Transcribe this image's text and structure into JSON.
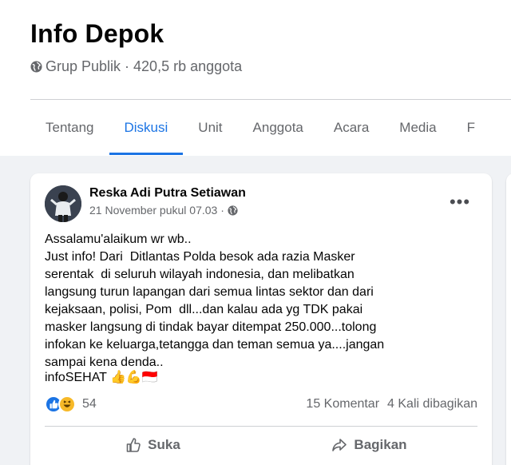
{
  "group": {
    "title": "Info Depok",
    "meta": "Grup Publik · 420,5 rb anggota"
  },
  "tabs": [
    {
      "label": "Tentang",
      "active": false
    },
    {
      "label": "Diskusi",
      "active": true
    },
    {
      "label": "Unit",
      "active": false
    },
    {
      "label": "Anggota",
      "active": false
    },
    {
      "label": "Acara",
      "active": false
    },
    {
      "label": "Media",
      "active": false
    },
    {
      "label": "F",
      "active": false
    }
  ],
  "post": {
    "author": "Reska Adi Putra Setiawan",
    "timestamp": "21 November pukul 07.03 ·",
    "body": "Assalamu'alaikum wr wb..\nJust info! Dari  Ditlantas Polda besok ada razia Masker\nserentak  di seluruh wilayah indonesia, dan melibatkan\nlangsung turun lapangan dari semua lintas sektor dan dari\nkejaksaan, polisi, Pom  dll...dan kalau ada yg TDK pakai\nmasker langsung di tindak bayar ditempat 250.000...tolong\ninfokan ke keluarga,tetangga dan teman semua ya....jangan\nsampai kena denda..",
    "tag": "infoSEHAT",
    "tag_emojis": "👍💪🇮🇩",
    "reaction_count": "54",
    "comments": "15 Komentar",
    "shares": "4 Kali dibagikan"
  },
  "actions": {
    "like": "Suka",
    "share": "Bagikan"
  },
  "colors": {
    "accent": "#1b74e4",
    "secondary_text": "#65676b",
    "background": "#f0f2f5"
  }
}
